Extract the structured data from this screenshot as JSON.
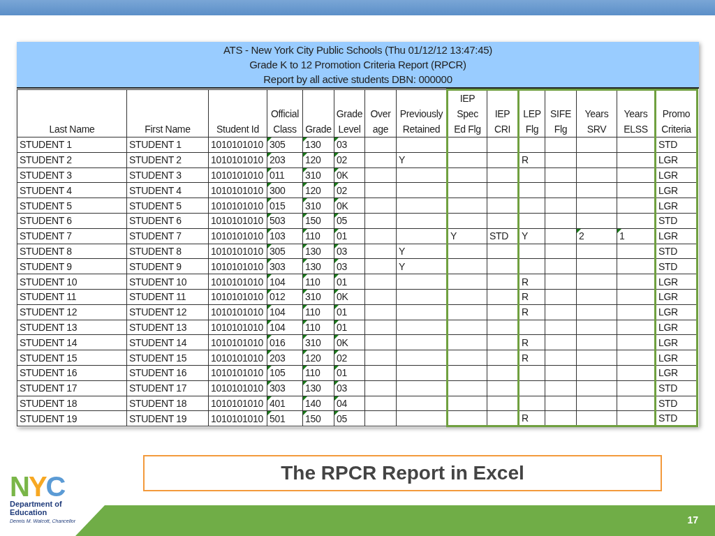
{
  "report": {
    "title_lines": [
      "ATS - New York City Public Schools (Thu 01/12/12 13:47:45)",
      "Grade K to 12 Promotion Criteria Report (RPCR)",
      "Report by all active students DBN: 000000"
    ]
  },
  "columns": [
    {
      "label": "Last Name"
    },
    {
      "label": "First Name"
    },
    {
      "label": "Student Id"
    },
    {
      "label": "Official\nClass",
      "indicator": true
    },
    {
      "label": "Grade",
      "indicator": true
    },
    {
      "label": "Grade\nLevel",
      "indicator": true
    },
    {
      "label": "Over\nage"
    },
    {
      "label": "Previously\nRetained"
    },
    {
      "label": "IEP\nSpec\nEd Flg",
      "outlined": true,
      "group_start": true
    },
    {
      "label": "IEP\nCRI",
      "outlined": true,
      "group_start": false
    },
    {
      "label": "LEP\nFlg",
      "outlined": true,
      "group_start": true
    },
    {
      "label": "SIFE\nFlg",
      "outlined": true,
      "group_start": false
    },
    {
      "label": "Years\nSRV",
      "indicator": true,
      "outlined": true,
      "group_start": false
    },
    {
      "label": "Years\nELSS",
      "indicator": true,
      "outlined": true,
      "group_start": false
    },
    {
      "label": "Promo\nCriteria",
      "outlined": true,
      "group_start": true
    }
  ],
  "rows": [
    {
      "last_name": "STUDENT 1",
      "first_name": "STUDENT 1",
      "student_id": "1010101010",
      "official_class": "305",
      "grade": "130",
      "grade_level": "03",
      "promo_criteria": "STD"
    },
    {
      "last_name": "STUDENT 2",
      "first_name": "STUDENT 2",
      "student_id": "1010101010",
      "official_class": "203",
      "grade": "120",
      "grade_level": "02",
      "previously_retained": "Y",
      "lep_flg": "R",
      "promo_criteria": "LGR"
    },
    {
      "last_name": "STUDENT 3",
      "first_name": "STUDENT 3",
      "student_id": "1010101010",
      "official_class": "011",
      "grade": "310",
      "grade_level": "0K",
      "promo_criteria": "LGR"
    },
    {
      "last_name": "STUDENT 4",
      "first_name": "STUDENT 4",
      "student_id": "1010101010",
      "official_class": "300",
      "grade": "120",
      "grade_level": "02",
      "promo_criteria": "LGR"
    },
    {
      "last_name": "STUDENT 5",
      "first_name": "STUDENT 5",
      "student_id": "1010101010",
      "official_class": "015",
      "grade": "310",
      "grade_level": "0K",
      "promo_criteria": "LGR"
    },
    {
      "last_name": "STUDENT 6",
      "first_name": "STUDENT 6",
      "student_id": "1010101010",
      "official_class": "503",
      "grade": "150",
      "grade_level": "05",
      "promo_criteria": "STD"
    },
    {
      "last_name": "STUDENT 7",
      "first_name": "STUDENT 7",
      "student_id": "1010101010",
      "official_class": "103",
      "grade": "110",
      "grade_level": "01",
      "iep_spec_ed_flg": "Y",
      "iep_cri": "STD",
      "lep_flg": "Y",
      "years_srv": "2",
      "years_elss": "1",
      "promo_criteria": "LGR"
    },
    {
      "last_name": "STUDENT 8",
      "first_name": "STUDENT 8",
      "student_id": "1010101010",
      "official_class": "305",
      "grade": "130",
      "grade_level": "03",
      "previously_retained": "Y",
      "promo_criteria": "STD"
    },
    {
      "last_name": "STUDENT 9",
      "first_name": "STUDENT 9",
      "student_id": "1010101010",
      "official_class": "303",
      "grade": "130",
      "grade_level": "03",
      "previously_retained": "Y",
      "promo_criteria": "STD"
    },
    {
      "last_name": "STUDENT 10",
      "first_name": "STUDENT 10",
      "student_id": "1010101010",
      "official_class": "104",
      "grade": "110",
      "grade_level": "01",
      "lep_flg": "R",
      "promo_criteria": "LGR"
    },
    {
      "last_name": "STUDENT 11",
      "first_name": "STUDENT 11",
      "student_id": "1010101010",
      "official_class": "012",
      "grade": "310",
      "grade_level": "0K",
      "lep_flg": "R",
      "promo_criteria": "LGR"
    },
    {
      "last_name": "STUDENT 12",
      "first_name": "STUDENT 12",
      "student_id": "1010101010",
      "official_class": "104",
      "grade": "110",
      "grade_level": "01",
      "lep_flg": "R",
      "promo_criteria": "LGR"
    },
    {
      "last_name": "STUDENT 13",
      "first_name": "STUDENT 13",
      "student_id": "1010101010",
      "official_class": "104",
      "grade": "110",
      "grade_level": "01",
      "promo_criteria": "LGR"
    },
    {
      "last_name": "STUDENT 14",
      "first_name": "STUDENT 14",
      "student_id": "1010101010",
      "official_class": "016",
      "grade": "310",
      "grade_level": "0K",
      "lep_flg": "R",
      "promo_criteria": "LGR"
    },
    {
      "last_name": "STUDENT 15",
      "first_name": "STUDENT 15",
      "student_id": "1010101010",
      "official_class": "203",
      "grade": "120",
      "grade_level": "02",
      "lep_flg": "R",
      "promo_criteria": "LGR"
    },
    {
      "last_name": "STUDENT 16",
      "first_name": "STUDENT 16",
      "student_id": "1010101010",
      "official_class": "105",
      "grade": "110",
      "grade_level": "01",
      "promo_criteria": "LGR"
    },
    {
      "last_name": "STUDENT 17",
      "first_name": "STUDENT 17",
      "student_id": "1010101010",
      "official_class": "303",
      "grade": "130",
      "grade_level": "03",
      "promo_criteria": "STD"
    },
    {
      "last_name": "STUDENT 18",
      "first_name": "STUDENT 18",
      "student_id": "1010101010",
      "official_class": "401",
      "grade": "140",
      "grade_level": "04",
      "promo_criteria": "STD"
    },
    {
      "last_name": "STUDENT 19",
      "first_name": "STUDENT 19",
      "student_id": "1010101010",
      "official_class": "501",
      "grade": "150",
      "grade_level": "05",
      "lep_flg": "R",
      "promo_criteria": "STD"
    }
  ],
  "caption": "The RPCR Report in Excel",
  "logo": {
    "wordmark": "NYC",
    "department": "Department of\nEducation",
    "chancellor": "Dennis M. Walcott, Chancellor"
  },
  "page_number": "17"
}
